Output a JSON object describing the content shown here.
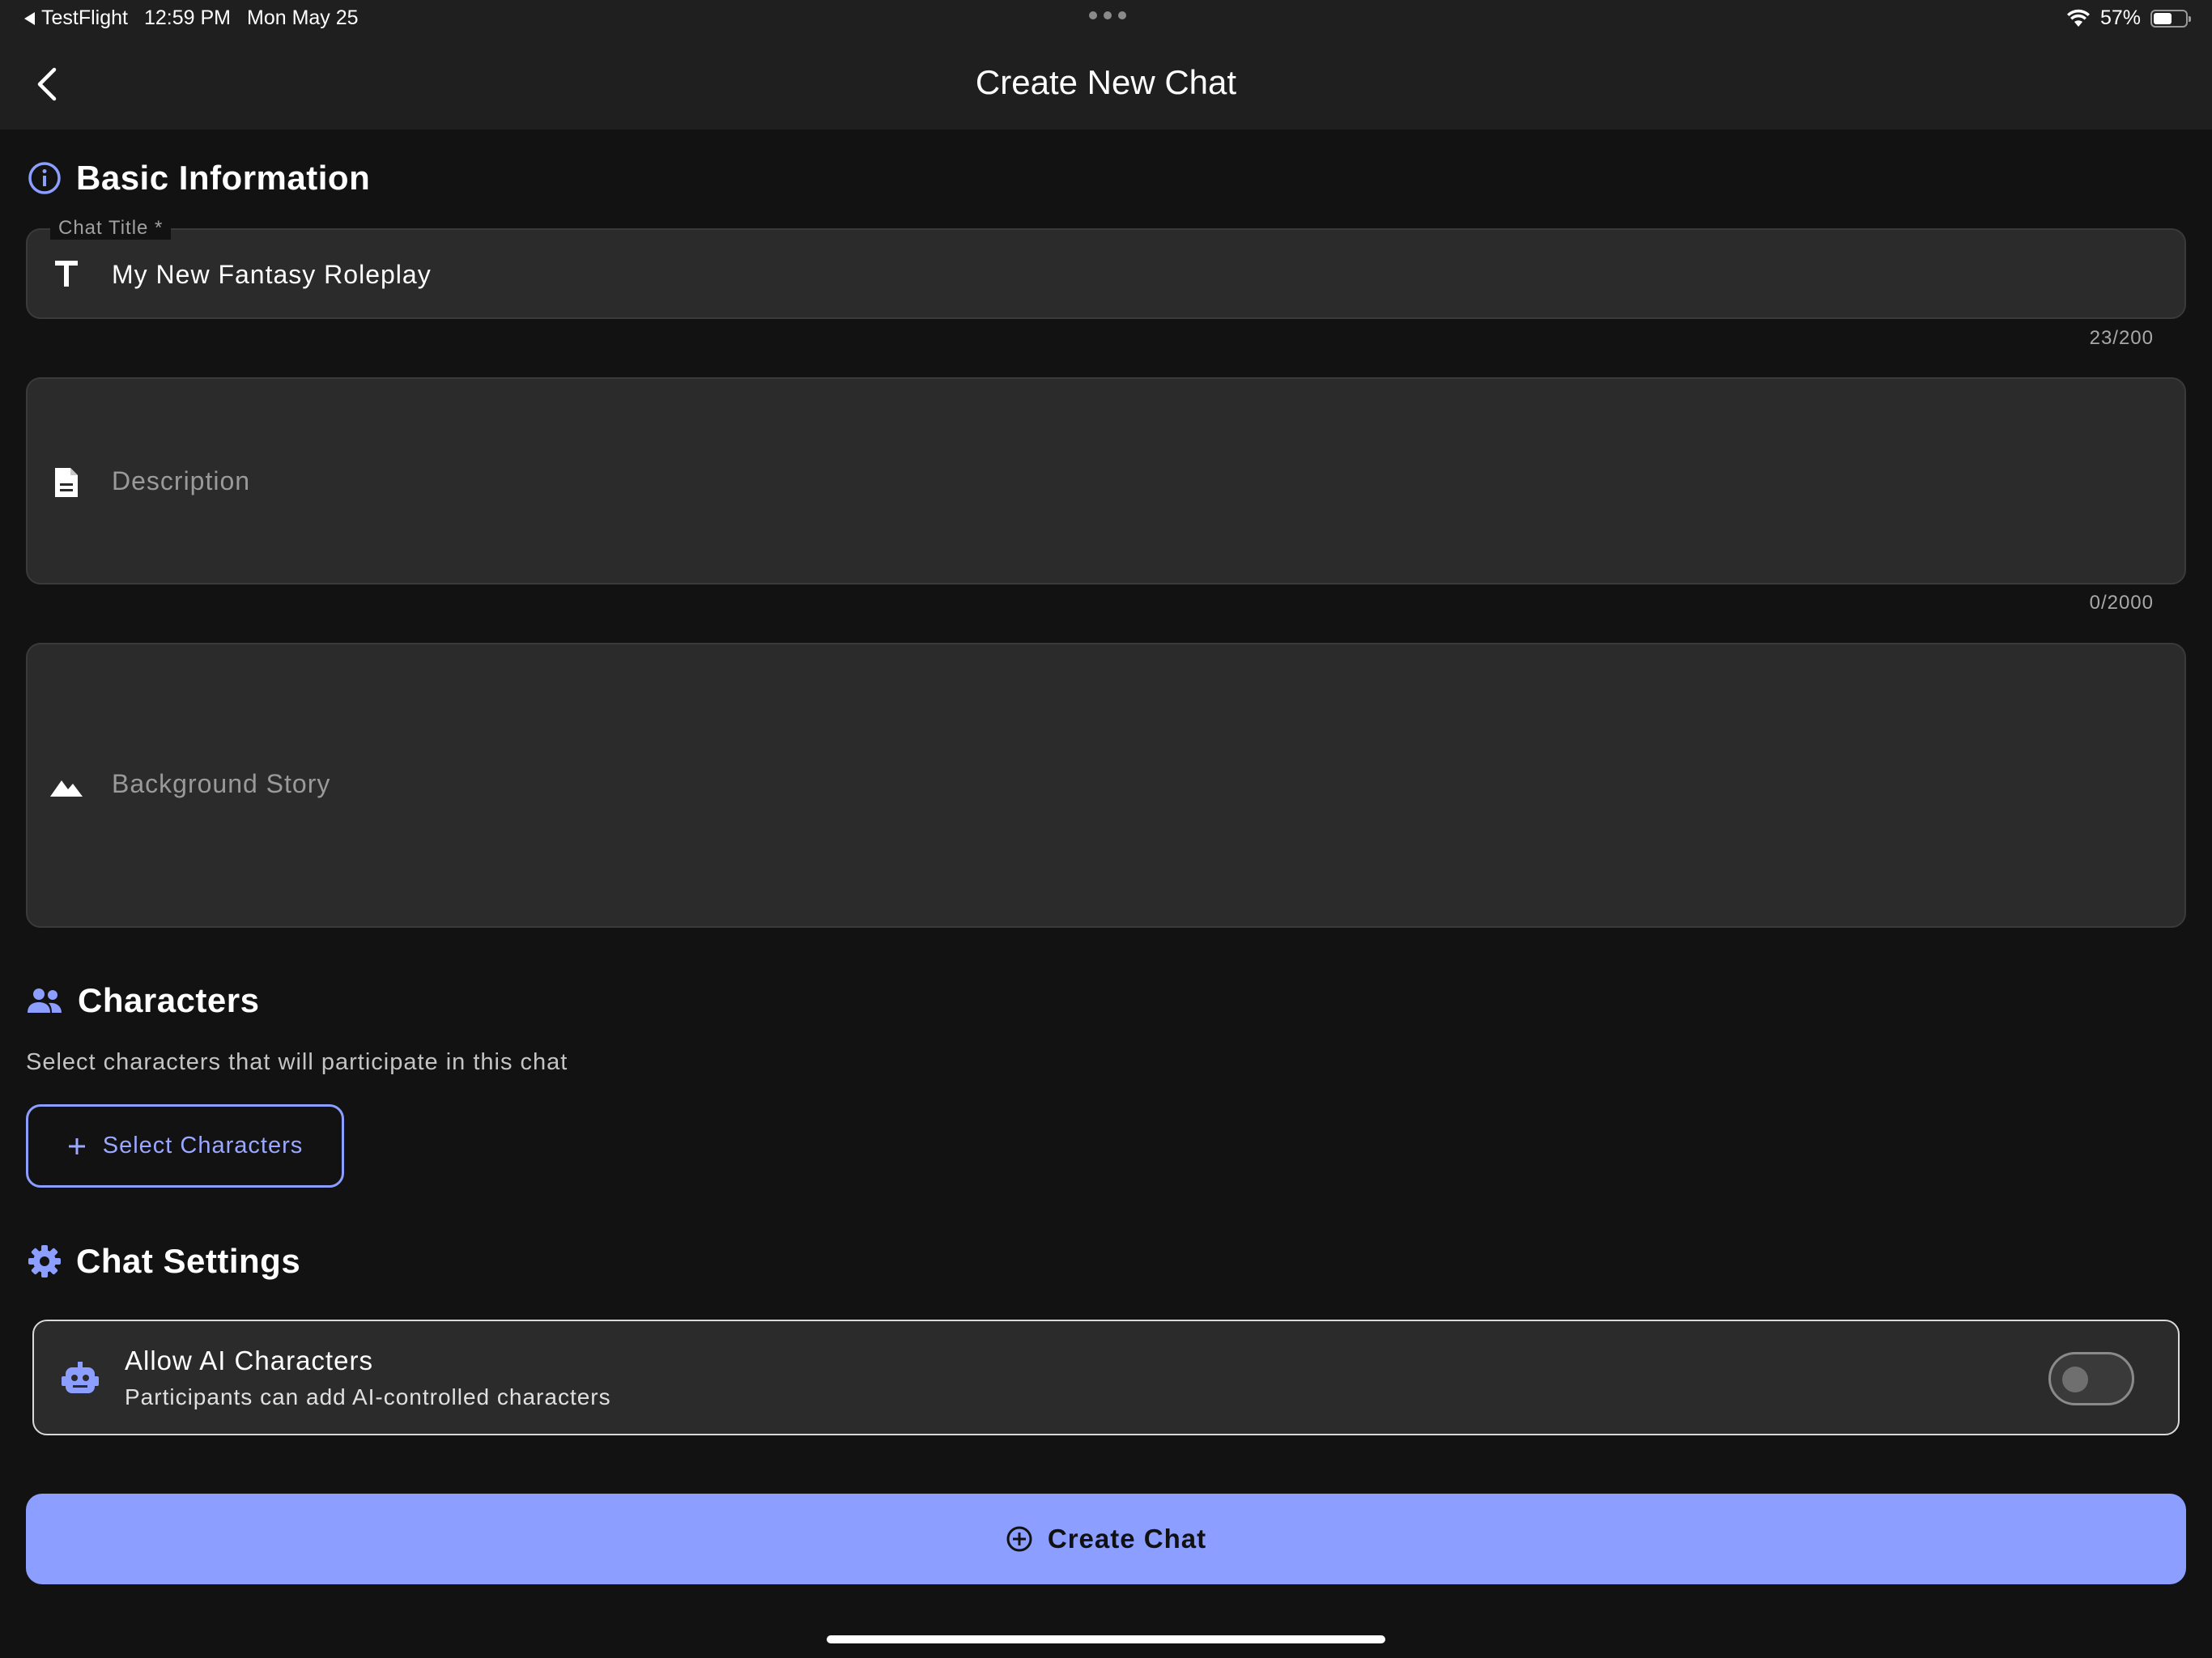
{
  "status_bar": {
    "back_app": "TestFlight",
    "time": "12:59 PM",
    "date": "Mon May 25",
    "battery": "57%",
    "battery_level": 0.57
  },
  "app_bar": {
    "title": "Create New Chat",
    "back_icon": "chevron-left-icon"
  },
  "basic_info": {
    "header": "Basic Information",
    "icon": "info-icon",
    "chat_title": {
      "label": "Chat Title *",
      "value": "My New Fantasy Roleplay",
      "counter": "23/200",
      "icon": "text-title-icon"
    },
    "description": {
      "placeholder": "Description",
      "counter": "0/2000",
      "icon": "document-icon"
    },
    "background_story": {
      "placeholder": "Background Story",
      "icon": "landscape-icon"
    }
  },
  "characters": {
    "header": "Characters",
    "icon": "people-icon",
    "subtitle": "Select characters that will participate in this chat",
    "select_button": "Select Characters"
  },
  "chat_settings": {
    "header": "Chat Settings",
    "icon": "gear-icon",
    "allow_ai": {
      "title": "Allow AI Characters",
      "subtitle": "Participants can add AI-controlled characters",
      "enabled": false,
      "icon": "robot-icon"
    }
  },
  "create_button": "Create Chat",
  "colors": {
    "accent": "#8c9eff",
    "background": "#121212",
    "surface": "#2b2b2b",
    "appbar": "#1f1f1f"
  }
}
